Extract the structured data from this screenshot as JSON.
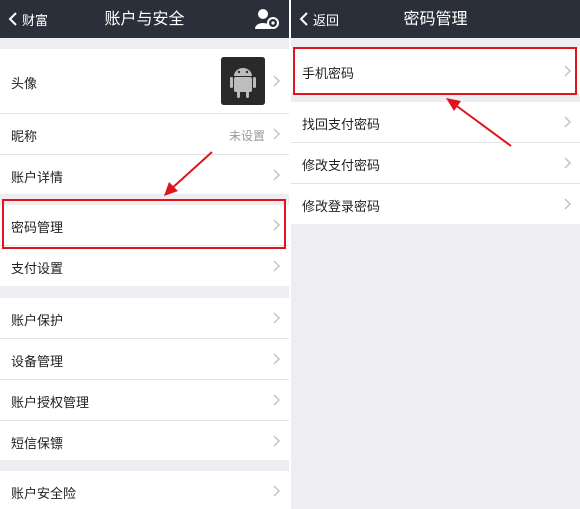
{
  "left_screen": {
    "back_label": "财富",
    "title": "账户与安全",
    "rows": {
      "avatar": "头像",
      "nickname": "昵称",
      "nickname_value": "未设置",
      "account_details": "账户详情",
      "password_management": "密码管理",
      "payment_settings": "支付设置",
      "account_protection": "账户保护",
      "device_management": "设备管理",
      "account_authorization": "账户授权管理",
      "sms_guard": "短信保镖",
      "account_insurance": "账户安全险"
    }
  },
  "right_screen": {
    "back_label": "返回",
    "title": "密码管理",
    "rows": {
      "phone_password": "手机密码",
      "recover_payment_password": "找回支付密码",
      "change_payment_password": "修改支付密码",
      "change_login_password": "修改登录密码"
    }
  },
  "colors": {
    "navbar": "#2b2f3a",
    "background": "#eeeef2",
    "highlight": "#e0151b"
  },
  "icons": {
    "back": "chevron-left-icon",
    "user_settings": "user-gear-icon",
    "row_arrow": "chevron-right-icon",
    "avatar": "android-robot-icon"
  }
}
